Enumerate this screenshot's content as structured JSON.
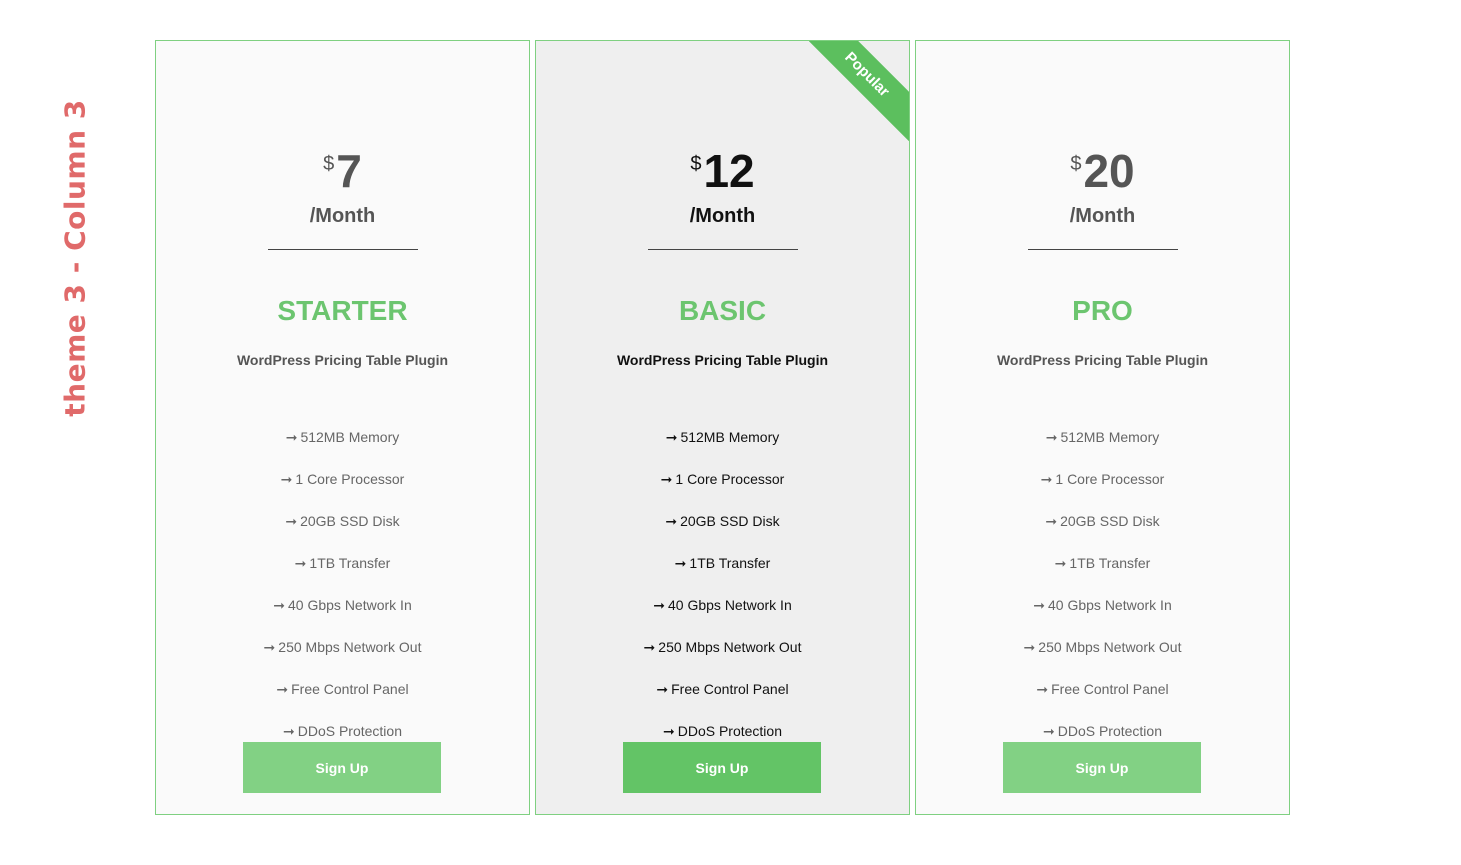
{
  "side_label": "theme 3 - Column 3",
  "colors": {
    "accent": "#6cc56f",
    "border": "#7fd081",
    "button": "#82d184",
    "button_featured": "#63c466",
    "ribbon": "#5cbf5e",
    "side_label": "#e06a6a"
  },
  "icons": {
    "feature_bullet": "arrow-right-icon"
  },
  "plans": [
    {
      "currency": "$",
      "amount": "7",
      "period": "/Month",
      "name": "STARTER",
      "subtitle": "WordPress Pricing Table Plugin",
      "arrow": "➞",
      "features": [
        "512MB Memory",
        "1 Core Processor",
        "20GB SSD Disk",
        "1TB Transfer",
        "40 Gbps Network In",
        "250 Mbps Network Out",
        "Free Control Panel",
        "DDoS Protection"
      ],
      "button": "Sign Up"
    },
    {
      "currency": "$",
      "amount": "12",
      "period": "/Month",
      "name": "BASIC",
      "subtitle": "WordPress Pricing Table Plugin",
      "arrow": "➞",
      "badge": "Popular",
      "features": [
        "512MB Memory",
        "1 Core Processor",
        "20GB SSD Disk",
        "1TB Transfer",
        "40 Gbps Network In",
        "250 Mbps Network Out",
        "Free Control Panel",
        "DDoS Protection"
      ],
      "button": "Sign Up"
    },
    {
      "currency": "$",
      "amount": "20",
      "period": "/Month",
      "name": "PRO",
      "subtitle": "WordPress Pricing Table Plugin",
      "arrow": "➞",
      "features": [
        "512MB Memory",
        "1 Core Processor",
        "20GB SSD Disk",
        "1TB Transfer",
        "40 Gbps Network In",
        "250 Mbps Network Out",
        "Free Control Panel",
        "DDoS Protection"
      ],
      "button": "Sign Up"
    }
  ]
}
